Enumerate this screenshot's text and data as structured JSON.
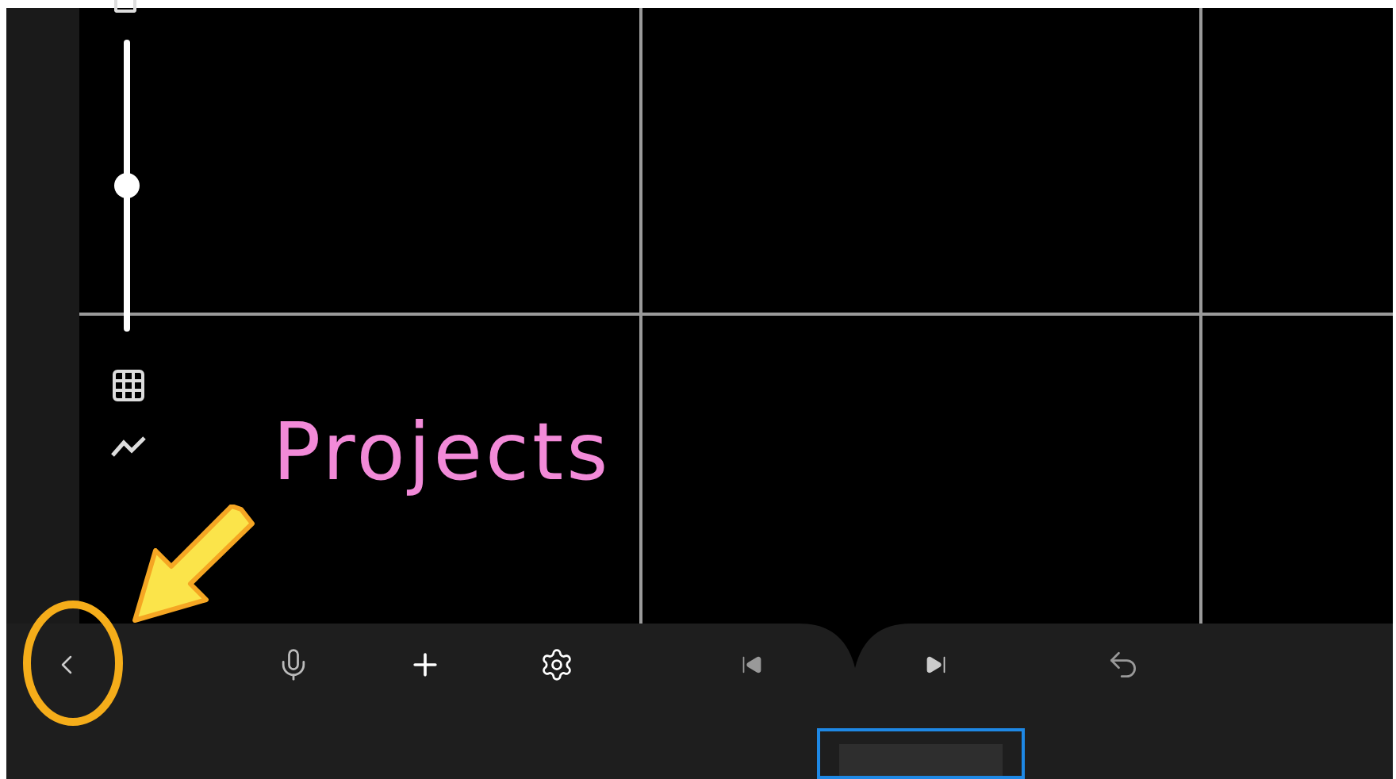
{
  "exposure_slider": {
    "level": 0.5
  },
  "annotation": {
    "text": "Projects"
  },
  "timeline": {
    "frames": [
      {
        "selected": true
      }
    ]
  }
}
